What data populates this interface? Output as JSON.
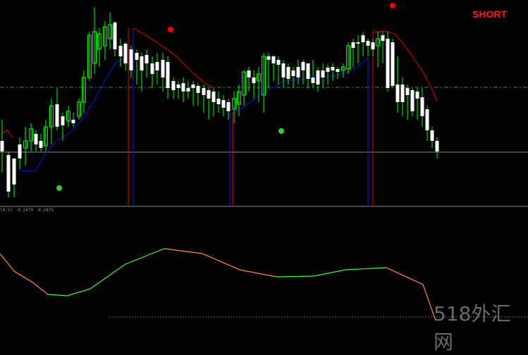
{
  "signal": {
    "text": "SHORT",
    "color": "#ff1a1a"
  },
  "indicator": {
    "label": "(4.5) -0.2479 -0.2475"
  },
  "watermark": {
    "text": "518外汇网"
  },
  "colors": {
    "background": "#000000",
    "candle_up": "#00ff00",
    "candle_down": "#ffffff",
    "trail_upper": "#c00000",
    "trail_lower": "#1010c0",
    "signal_dot_sell": "#ff0000",
    "signal_dot_buy": "#33cc33",
    "osc_rising": "#33ff33",
    "osc_falling": "#ff8c3a",
    "dash_level": "#2e8b57"
  },
  "icons": [
    "sell-dot-icon",
    "buy-dot-icon"
  ]
}
